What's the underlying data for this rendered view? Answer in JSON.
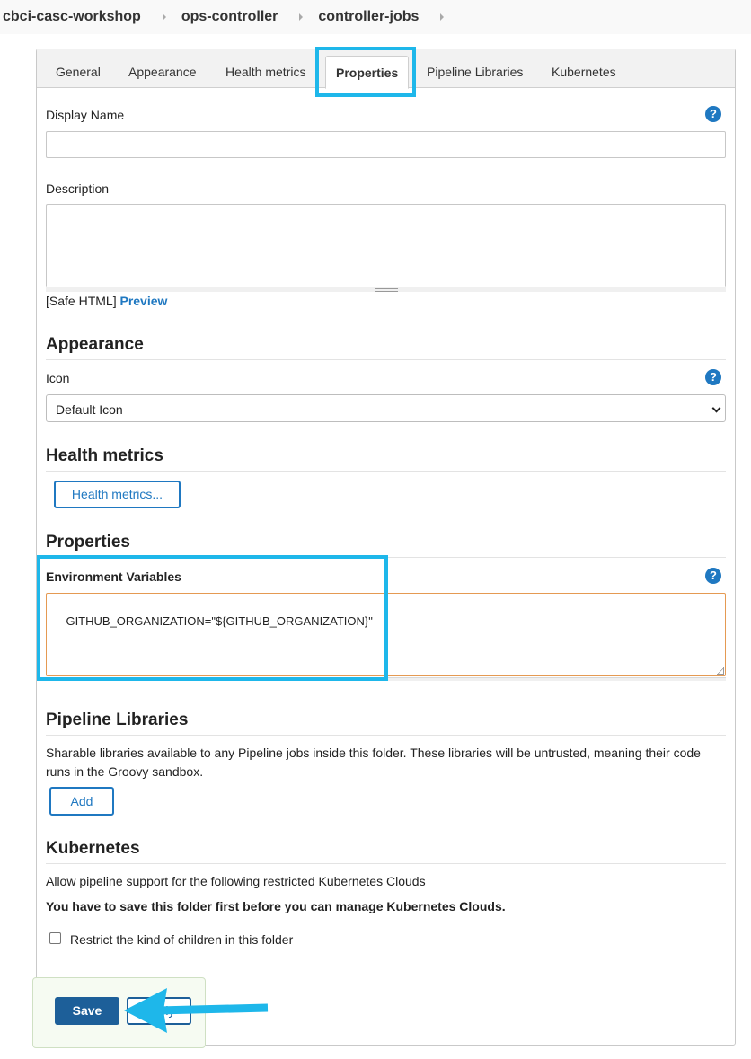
{
  "breadcrumb": {
    "items": [
      "cbci-casc-workshop",
      "ops-controller",
      "controller-jobs"
    ]
  },
  "tabs": [
    {
      "label": "General"
    },
    {
      "label": "Appearance"
    },
    {
      "label": "Health metrics"
    },
    {
      "label": "Properties",
      "active": true
    },
    {
      "label": "Pipeline Libraries"
    },
    {
      "label": "Kubernetes"
    }
  ],
  "general": {
    "display_name_label": "Display Name",
    "display_name_value": "",
    "description_label": "Description",
    "description_value": "",
    "safe_html_label": "[Safe HTML]",
    "preview_link": "Preview"
  },
  "appearance": {
    "title": "Appearance",
    "icon_label": "Icon",
    "icon_selected": "Default Icon"
  },
  "health_metrics": {
    "title": "Health metrics",
    "button_label": "Health metrics..."
  },
  "properties": {
    "title": "Properties",
    "env_vars_label": "Environment Variables",
    "env_vars_value": "GITHUB_ORGANIZATION=\"${GITHUB_ORGANIZATION}\""
  },
  "pipeline_libraries": {
    "title": "Pipeline Libraries",
    "description_line1": "Sharable libraries available to any Pipeline jobs inside this folder. These libraries will be untrusted, meaning their code",
    "description_line2": "runs in the Groovy sandbox.",
    "add_button": "Add"
  },
  "kubernetes": {
    "title": "Kubernetes",
    "allow_text": "Allow pipeline support for the following restricted Kubernetes Clouds",
    "save_first_text": "You have to save this folder first before you can manage Kubernetes Clouds.",
    "restrict_label": "Restrict the kind of children in this folder",
    "restrict_checked": false
  },
  "help_icon_glyph": "?",
  "actions": {
    "save_label": "Save",
    "apply_label": "Apply"
  },
  "colors": {
    "accent": "#1f78c1",
    "highlight": "#1eb7ea",
    "save_button": "#1d5f99",
    "env_border": "#e59a52"
  }
}
